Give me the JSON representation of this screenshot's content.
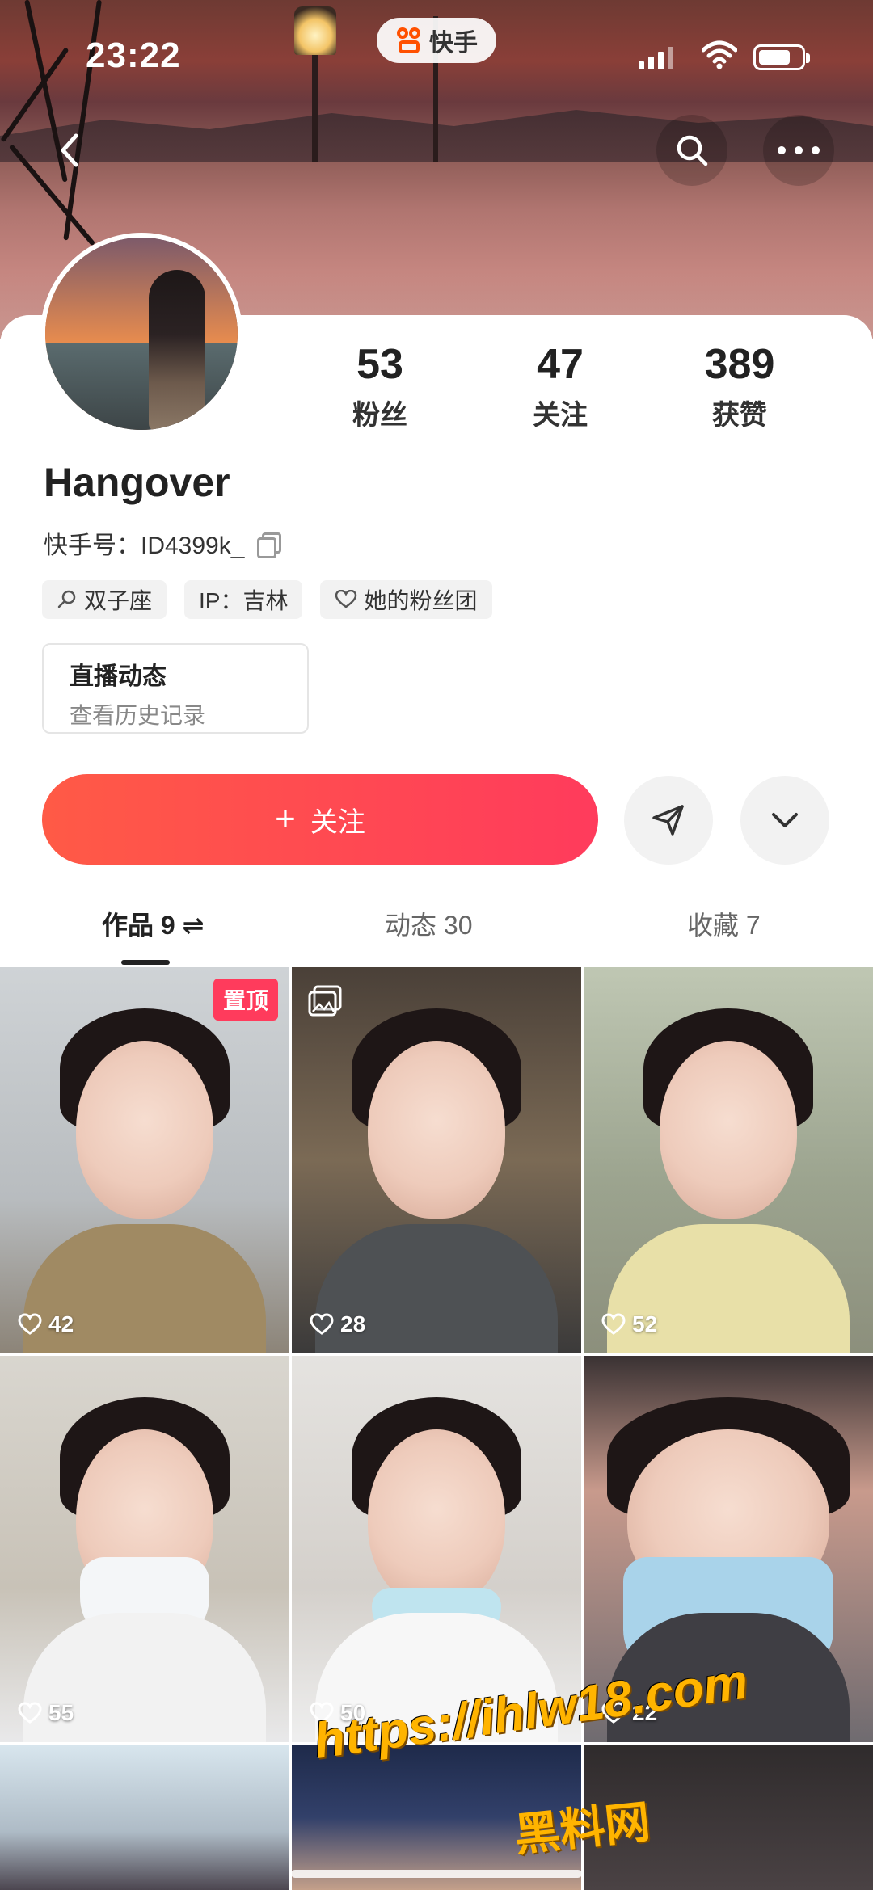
{
  "status_bar": {
    "time": "23:22",
    "app_name": "快手"
  },
  "profile": {
    "name": "Hangover",
    "kuaishou_id_label": "快手号：ID4399k_",
    "stats": [
      {
        "value": "53",
        "label": "粉丝"
      },
      {
        "value": "47",
        "label": "关注"
      },
      {
        "value": "389",
        "label": "获赞"
      }
    ],
    "tags": [
      {
        "icon": "zodiac-icon",
        "text": "双子座"
      },
      {
        "icon": "",
        "text": "IP：吉林"
      },
      {
        "icon": "fan-club-icon",
        "text": "她的粉丝团"
      }
    ],
    "live": {
      "title": "直播动态",
      "subtitle": "查看历史记录"
    },
    "follow_label": "关注"
  },
  "tabs": [
    {
      "label": "作品 9 ⇌",
      "active": true
    },
    {
      "label": "动态 30",
      "active": false
    },
    {
      "label": "收藏 7",
      "active": false
    }
  ],
  "posts": [
    {
      "likes": "42",
      "badge": "置顶",
      "multi_image": false
    },
    {
      "likes": "28",
      "badge": "",
      "multi_image": true
    },
    {
      "likes": "52",
      "badge": "",
      "multi_image": false
    },
    {
      "likes": "55",
      "badge": "",
      "multi_image": false
    },
    {
      "likes": "50",
      "badge": "",
      "multi_image": false
    },
    {
      "likes": "22",
      "badge": "",
      "multi_image": false
    },
    {
      "likes": "",
      "badge": "",
      "multi_image": false
    },
    {
      "likes": "",
      "badge": "",
      "multi_image": false
    },
    {
      "likes": "",
      "badge": "",
      "multi_image": false
    }
  ],
  "watermark": {
    "url": "https://ihlw18.com",
    "text": "黑料网"
  },
  "colors": {
    "accent": "#ff3b5c",
    "follow_start": "#ff5a46",
    "follow_end": "#ff3b5c",
    "brand": "#ff5000",
    "watermark": "#ffb400"
  }
}
